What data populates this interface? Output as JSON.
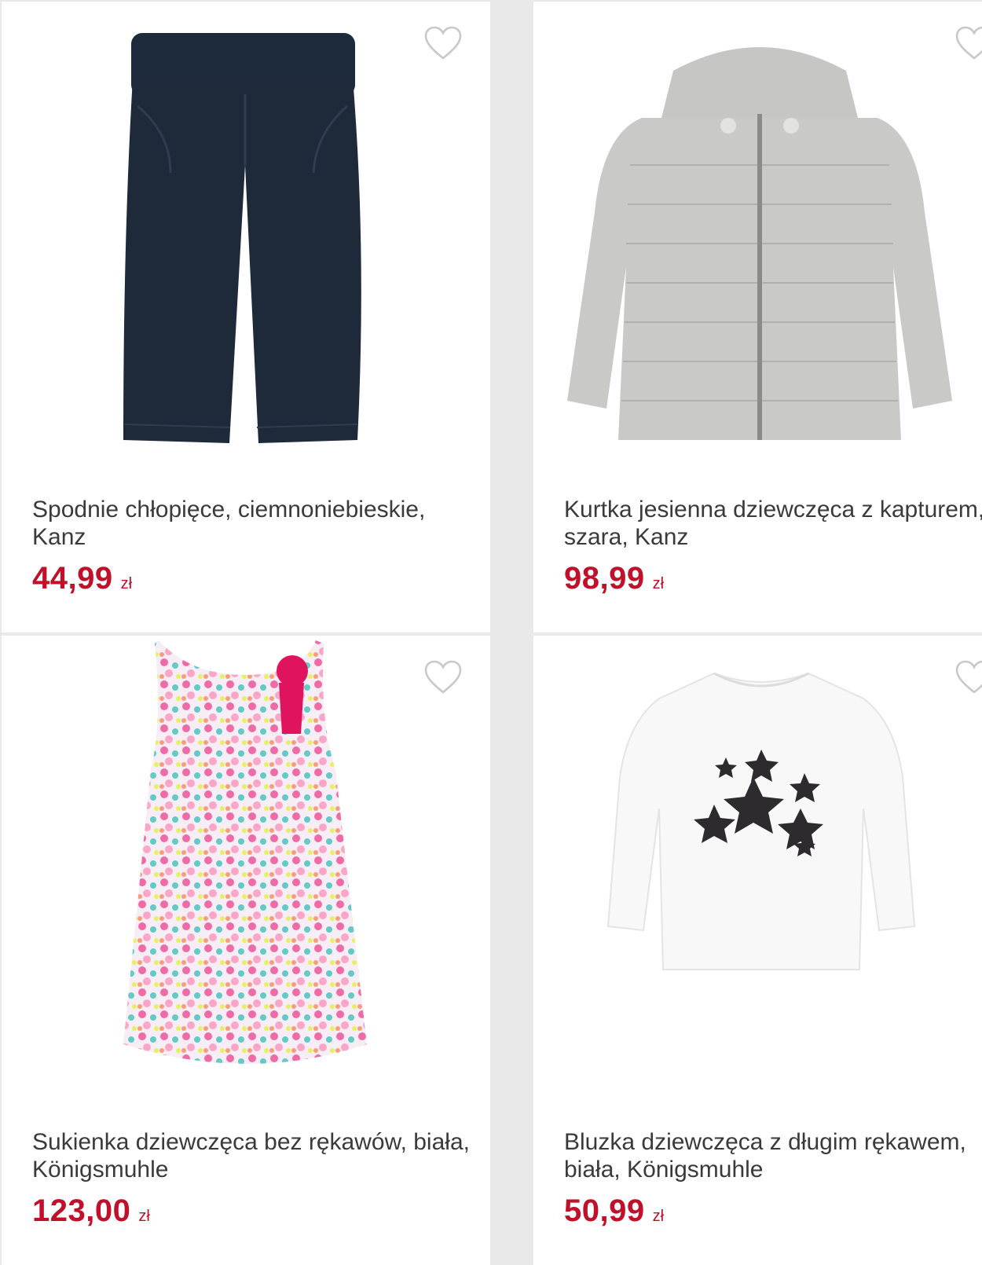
{
  "colors": {
    "price": "#c0102a",
    "title": "#3a3a3a",
    "background": "#e9e9e9",
    "card": "#ffffff"
  },
  "products": [
    {
      "image": "navy-corduroy-pants",
      "title": "Spodnie chłopięce, ciemnoniebieskie, Kanz",
      "price": "44,99",
      "currency": "zł",
      "wishlist_icon": "heart-outline-icon"
    },
    {
      "image": "grey-puffer-jacket",
      "title": "Kurtka jesienna dziewczęca z kapturem, szara, Kanz",
      "price": "98,99",
      "currency": "zł",
      "wishlist_icon": "heart-outline-icon"
    },
    {
      "image": "heart-print-dress",
      "title": "Sukienka dziewczęca bez rękawów, biała, Königsmuhle",
      "price": "123,00",
      "currency": "zł",
      "wishlist_icon": "heart-outline-icon"
    },
    {
      "image": "white-star-longsleeve",
      "title": "Bluzka dziewczęca z długim rękawem, biała, Königsmuhle",
      "price": "50,99",
      "currency": "zł",
      "wishlist_icon": "heart-outline-icon"
    }
  ]
}
